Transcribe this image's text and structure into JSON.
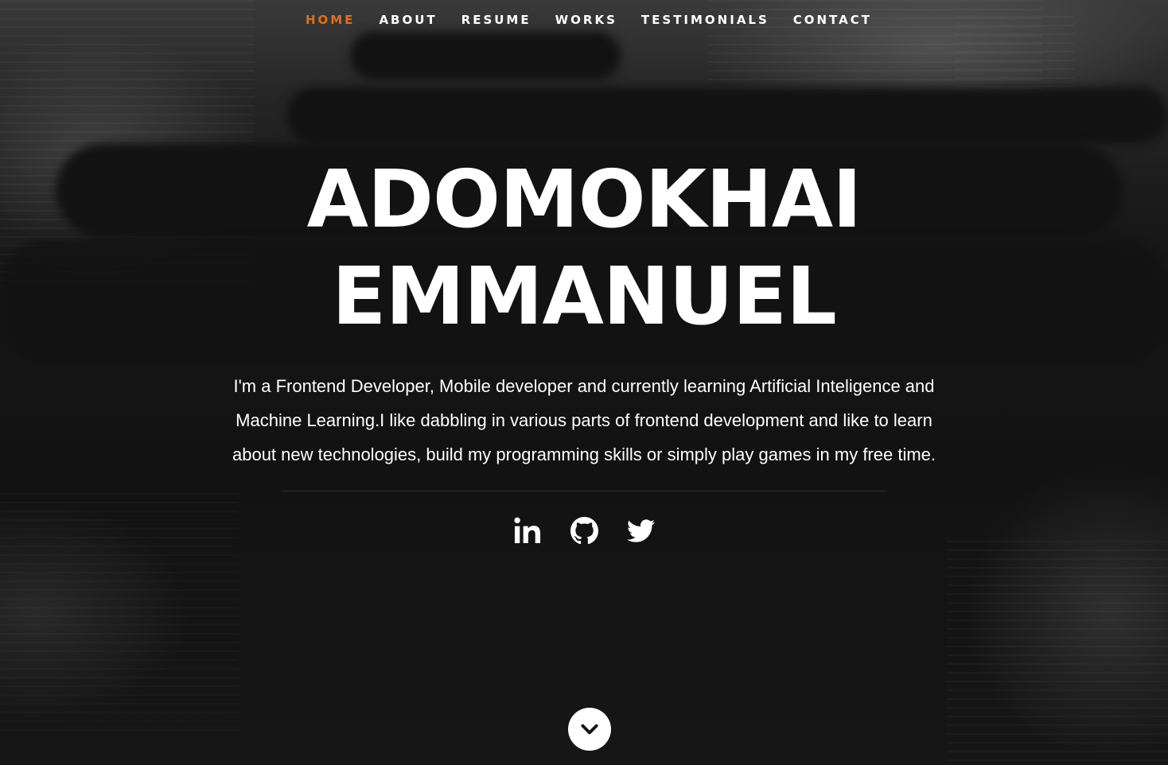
{
  "nav": {
    "items": [
      {
        "label": "HOME",
        "active": true
      },
      {
        "label": "ABOUT",
        "active": false
      },
      {
        "label": "RESUME",
        "active": false
      },
      {
        "label": "WORKS",
        "active": false
      },
      {
        "label": "TESTIMONIALS",
        "active": false
      },
      {
        "label": "CONTACT",
        "active": false
      }
    ]
  },
  "banner": {
    "name_line1": "ADOMOKHAI",
    "name_line2": "EMMANUEL",
    "intro": "I'm a Frontend Developer, Mobile developer and currently learning Artificial Inteligence and Machine Learning.I like dabbling in various parts of frontend development and like to learn about new technologies, build my programming skills or simply play games in my free time."
  },
  "social": {
    "icons": [
      "linkedin-icon",
      "github-icon",
      "twitter-icon"
    ]
  },
  "scroll": {
    "icon": "chevron-down-icon"
  },
  "colors": {
    "accent": "#e06e1c",
    "text": "#ffffff",
    "background": "#141414"
  }
}
